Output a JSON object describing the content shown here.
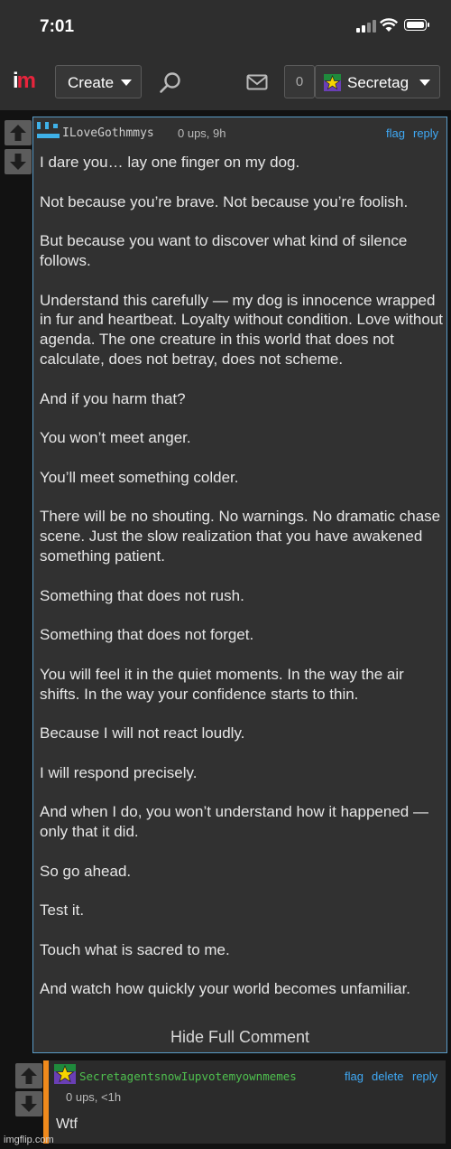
{
  "status_bar": {
    "time": "7:01"
  },
  "nav": {
    "logo_i": "i",
    "logo_m": "m",
    "create_label": "Create",
    "notification_count": "0",
    "username": "Secretag"
  },
  "comment": {
    "username": "ILoveGothmmys",
    "meta": "0 ups, 9h",
    "flag": "flag",
    "reply": "reply",
    "paragraphs": [
      "I dare you… lay one finger on my dog.",
      "Not because you’re brave. Not because you’re foolish.",
      "But because you want to discover what kind of silence follows.",
      "Understand this carefully — my dog is innocence wrapped in fur and heartbeat. Loyalty without condition. Love without agenda. The one creature in this world that does not calculate, does not betray, does not scheme.",
      "And if you harm that?",
      "You won’t meet anger.",
      "You’ll meet something colder.",
      "There will be no shouting. No warnings. No dramatic chase scene. Just the slow realization that you have awakened something patient.",
      "Something that does not rush.",
      "Something that does not forget.",
      "You will feel it in the quiet moments. In the way the air shifts. In the way your confidence starts to thin.",
      "Because I will not react loudly.",
      "I will respond precisely.",
      "And when I do, you won’t understand how it happened — only that it did.",
      "So go ahead.",
      "Test it.",
      "Touch what is sacred to me.",
      "And watch how quickly your world becomes unfamiliar."
    ],
    "hide_full": "Hide Full Comment"
  },
  "reply": {
    "username": "SecretagentsnowIupvotemyownmemes",
    "meta": "0 ups, <1h",
    "flag": "flag",
    "delete": "delete",
    "reply": "reply",
    "body": "Wtf"
  },
  "watermark": "imgflip.com",
  "colors": {
    "accent_blue": "#3fa9f5",
    "reply_border": "#f08a1c",
    "reply_username": "#4fc04f",
    "logo_m": "#e8243c"
  }
}
